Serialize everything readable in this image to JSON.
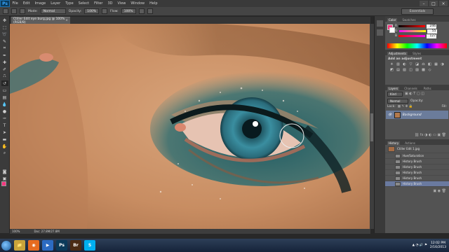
{
  "app": {
    "name": "Ps"
  },
  "menu": [
    "File",
    "Edit",
    "Image",
    "Layer",
    "Type",
    "Select",
    "Filter",
    "3D",
    "View",
    "Window",
    "Help"
  ],
  "window_controls": [
    "–",
    "□",
    "×"
  ],
  "options": {
    "mode_label": "Mode:",
    "mode_value": "Normal",
    "opacity_label": "Opacity:",
    "opacity_value": "100%",
    "flow_label": "Flow:",
    "flow_value": "100%",
    "workspace": "Essentials"
  },
  "document": {
    "tab_title": "Ctiller Edit eye burg.jpg @ 100% (RGB/8)",
    "close": "×",
    "zoom": "100%",
    "doc_size": "Doc: 27.8M/27.8M"
  },
  "colors": {
    "accent": "#1b6fb0",
    "iris": "#2f7e92",
    "skin": "#c89268",
    "eyeshadow": "#1e5b63",
    "selection": "#6a7aa0"
  },
  "color_panel": {
    "tabs": [
      "Color",
      "Swatches"
    ],
    "channels": [
      {
        "label": "R",
        "value": "246"
      },
      {
        "label": "G",
        "value": "55"
      },
      {
        "label": "B",
        "value": "127"
      }
    ]
  },
  "adjustments_panel": {
    "tabs": [
      "Adjustments",
      "Styles"
    ],
    "heading": "Add an adjustment",
    "icons": [
      "☀",
      "▥",
      "◐",
      "▽",
      "◪",
      "⚖",
      "◧",
      "▦",
      "◑",
      "◩",
      "▤",
      "▧",
      "◫",
      "▨",
      "▩",
      "◇"
    ]
  },
  "layers_panel": {
    "tabs": [
      "Layers",
      "Channels",
      "Paths"
    ],
    "kind_label": "Kind",
    "blend_value": "Normal",
    "opacity_label": "Opacity:",
    "lock_label": "Lock:",
    "fill_label": "Fill:",
    "layers": [
      {
        "name": "Background",
        "visible_icon": "eye-icon"
      }
    ]
  },
  "history_panel": {
    "tabs": [
      "History",
      "Actions"
    ],
    "snapshot": "Ctiller Edit 1.jpg",
    "states": [
      "Hue/Saturation",
      "History Brush",
      "History Brush",
      "History Brush",
      "History Brush",
      "History Brush"
    ]
  },
  "taskbar": {
    "apps": [
      {
        "name": "windows-explorer",
        "glyph": "📁",
        "bg": "#c9a43a"
      },
      {
        "name": "firefox",
        "glyph": "◉",
        "bg": "#e66b1f"
      },
      {
        "name": "media-player",
        "glyph": "▶",
        "bg": "#2c6bc2"
      },
      {
        "name": "photoshop",
        "glyph": "Ps",
        "bg": "#0b3a5a"
      },
      {
        "name": "bridge",
        "glyph": "Br",
        "bg": "#4b2b14"
      },
      {
        "name": "skype",
        "glyph": "S",
        "bg": "#00aff0"
      }
    ],
    "time": "12:02 PM",
    "date": "2/16/2013"
  }
}
